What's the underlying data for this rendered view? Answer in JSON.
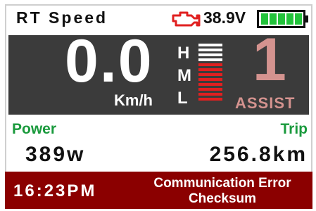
{
  "header": {
    "title": "RT Speed",
    "engine_icon": "engine-warning-icon",
    "voltage": "38.9V",
    "battery_icon": "battery-icon",
    "battery_level": 1.0
  },
  "display": {
    "speed": "0.0",
    "unit": "Km/h",
    "levels": [
      "H",
      "M",
      "L"
    ],
    "assist_level": "1",
    "assist_label": "ASSIST",
    "bar_count": 12,
    "bars_active_red": 8
  },
  "stats": {
    "power_label": "Power",
    "power_value": "389w",
    "trip_label": "Trip",
    "trip_value": "256.8km"
  },
  "status": {
    "time": "16:23PM",
    "error_line1": "Communication Error",
    "error_line2": "Checksum"
  },
  "colors": {
    "panel": "#3b3b3b",
    "status_bar": "#8b0000",
    "label_green": "#1a9a3d",
    "assist": "#d4938f",
    "engine": "#e02020",
    "battery_fill": "#22c33b"
  }
}
